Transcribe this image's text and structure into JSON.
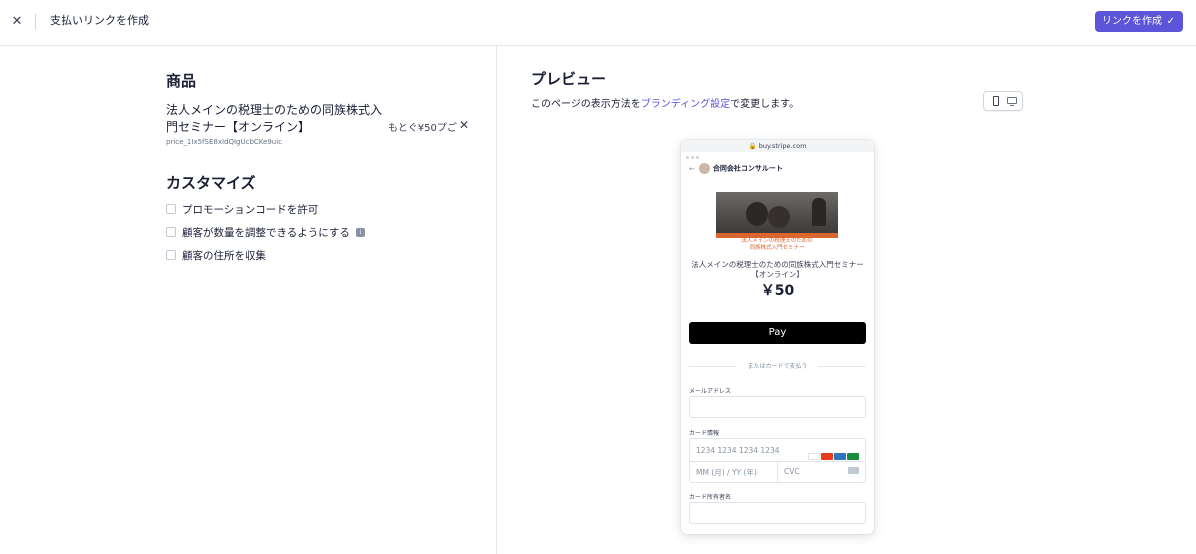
{
  "topbar": {
    "close_icon": "close-icon",
    "title": "支払いリンクを作成",
    "create_button_label": "リンクを作成",
    "create_button_icon": "check-icon",
    "accent": "#5c54d9"
  },
  "product_section": {
    "title": "商品",
    "product_name": "法人メインの税理士のための同族株式入門セミナー【オンライン】",
    "price_id": "price_1Ix5fSE8xIdQIgUcbCKe9uic",
    "price_text": "もとぐ¥50プご"
  },
  "customize_section": {
    "title": "カスタマイズ",
    "options": [
      {
        "label": "プロモーションコードを許可",
        "checked": false
      },
      {
        "label": "顧客が数量を調整できるようにする",
        "checked": false,
        "info": "i"
      },
      {
        "label": "顧客の住所を収集",
        "checked": false
      }
    ]
  },
  "preview": {
    "title": "プレビュー",
    "desc_prefix": "このページの表示方法を",
    "desc_link": "ブランディング設定",
    "desc_suffix": "で変更します。",
    "device_icons": [
      "mobile-icon",
      "desktop-icon"
    ]
  },
  "phone": {
    "url": "🔒 buy.stripe.com",
    "merchant": "合同会社コンサルート",
    "thumb_caption_1": "法人メインの税理士のための",
    "thumb_caption_2": "同族株式入門セミナー",
    "product_name": "法人メインの税理士のための同族株式入門セミナー【オンライン】",
    "price": "￥50",
    "applepay_label": "Pay",
    "or_text": "またはカードで支払う",
    "email_label": "メールアドレス",
    "card_label": "カード情報",
    "card_number_placeholder": "1234 1234 1234 1234",
    "expiry_placeholder": "MM (月) / YY (年)",
    "cvc_placeholder": "CVC",
    "holder_label": "カード所有者名",
    "card_logos": [
      "visa-icon",
      "mastercard-icon",
      "amex-icon",
      "jcb-icon"
    ]
  }
}
